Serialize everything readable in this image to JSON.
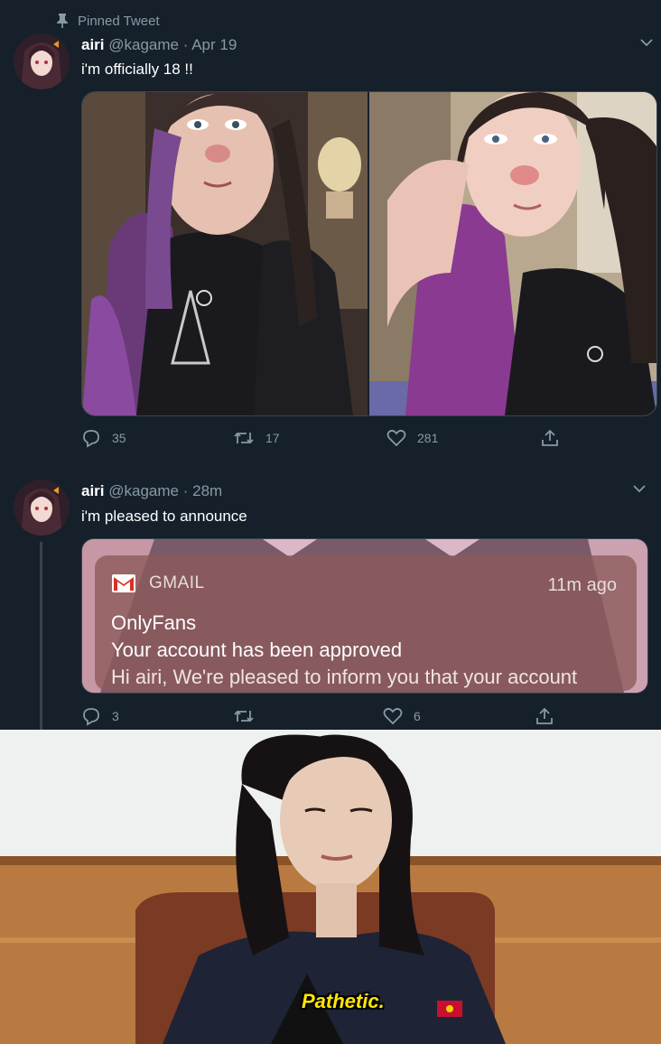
{
  "pinned_label": "Pinned Tweet",
  "tweet1": {
    "name": "airi",
    "handle": "@kagame",
    "time": "· Apr 19",
    "text": "i'm officially 18 !!",
    "replies": "35",
    "retweets": "17",
    "likes": "281"
  },
  "tweet2": {
    "name": "airi",
    "handle": "@kagame",
    "time": "· 28m",
    "text": "i'm pleased to announce",
    "replies": "3",
    "retweets": "",
    "likes": "6",
    "notification": {
      "app": "GMAIL",
      "time": "11m ago",
      "title": "OnlyFans",
      "subtitle": "Your account has been approved",
      "body": "Hi airi, We're pleased to inform you that your account"
    }
  },
  "meme_caption": "Pathetic.",
  "colors": {
    "background": "#15202b",
    "muted": "#8899a6",
    "border": "#38444d",
    "caption": "#ffe600"
  }
}
